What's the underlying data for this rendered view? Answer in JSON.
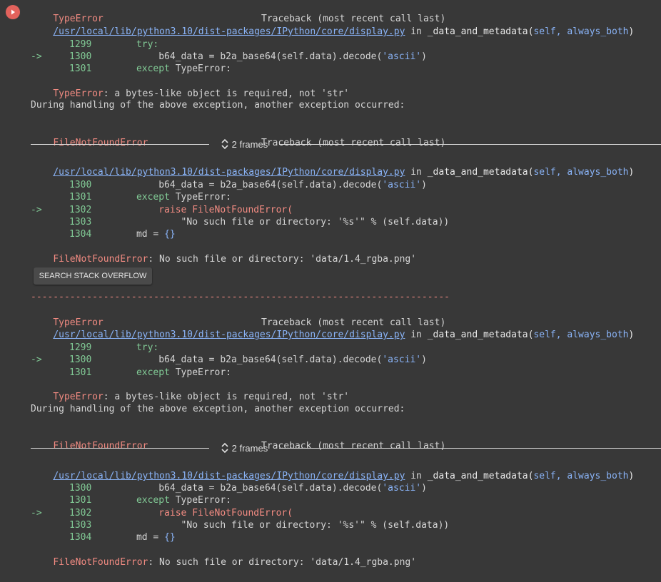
{
  "run_button": {
    "icon": "arrow-right-icon",
    "color": "#e2625c"
  },
  "blocks": [
    {
      "type_error": {
        "name": "TypeError",
        "traceback_title": "Traceback (most recent call last)",
        "path": "/usr/local/lib/python3.10/dist-packages/IPython/core/display.py",
        "in_word": " in ",
        "func": "_data_and_metadata",
        "args": "self, always_both",
        "lines": [
          {
            "no": "1299",
            "prefix": "",
            "indent": "        ",
            "code": "try:",
            "type": "kw"
          },
          {
            "no": "1300",
            "prefix": "-> ",
            "indent": "            ",
            "code_a": "b64_data = b2a_base64(self.data).decode(",
            "code_b": "'ascii'",
            "code_c": ")",
            "type": "call"
          },
          {
            "no": "1301",
            "prefix": "",
            "indent": "        ",
            "code_a": "except ",
            "code_b": "TypeError:",
            "type": "except"
          }
        ],
        "message": ": a bytes-like object is required, not 'str'"
      },
      "during": "During handling of the above exception, another exception occurred:",
      "fnf_error": {
        "name": "FileNotFoundError",
        "traceback_title": "Traceback (most recent call last)",
        "frames_label": "2 frames",
        "path": "/usr/local/lib/python3.10/dist-packages/IPython/core/display.py",
        "in_word": " in ",
        "func": "_data_and_metadata",
        "args": "self, always_both",
        "lines": [
          {
            "no": "1300",
            "prefix": "",
            "indent": "            ",
            "code_a": "b64_data = b2a_base64(self.data).decode(",
            "code_b": "'ascii'",
            "code_c": ")"
          },
          {
            "no": "1301",
            "prefix": "",
            "indent": "        ",
            "code_a": "except ",
            "code_b": "TypeError:"
          },
          {
            "no": "1302",
            "prefix": "-> ",
            "indent": "            ",
            "code_a": "raise FileNotFoundError("
          },
          {
            "no": "1303",
            "prefix": "",
            "indent": "                ",
            "code_a": "\"No such file or directory: '%s'\" % (self.data))"
          },
          {
            "no": "1304",
            "prefix": "",
            "indent": "        ",
            "code_a": "md = ",
            "code_b": "{}"
          }
        ],
        "message": ": No such file or directory: 'data/1.4_rgba.png'"
      }
    }
  ],
  "search_stack_overflow": "SEARCH STACK OVERFLOW",
  "separator": "---------------------------------------------------------------------------"
}
